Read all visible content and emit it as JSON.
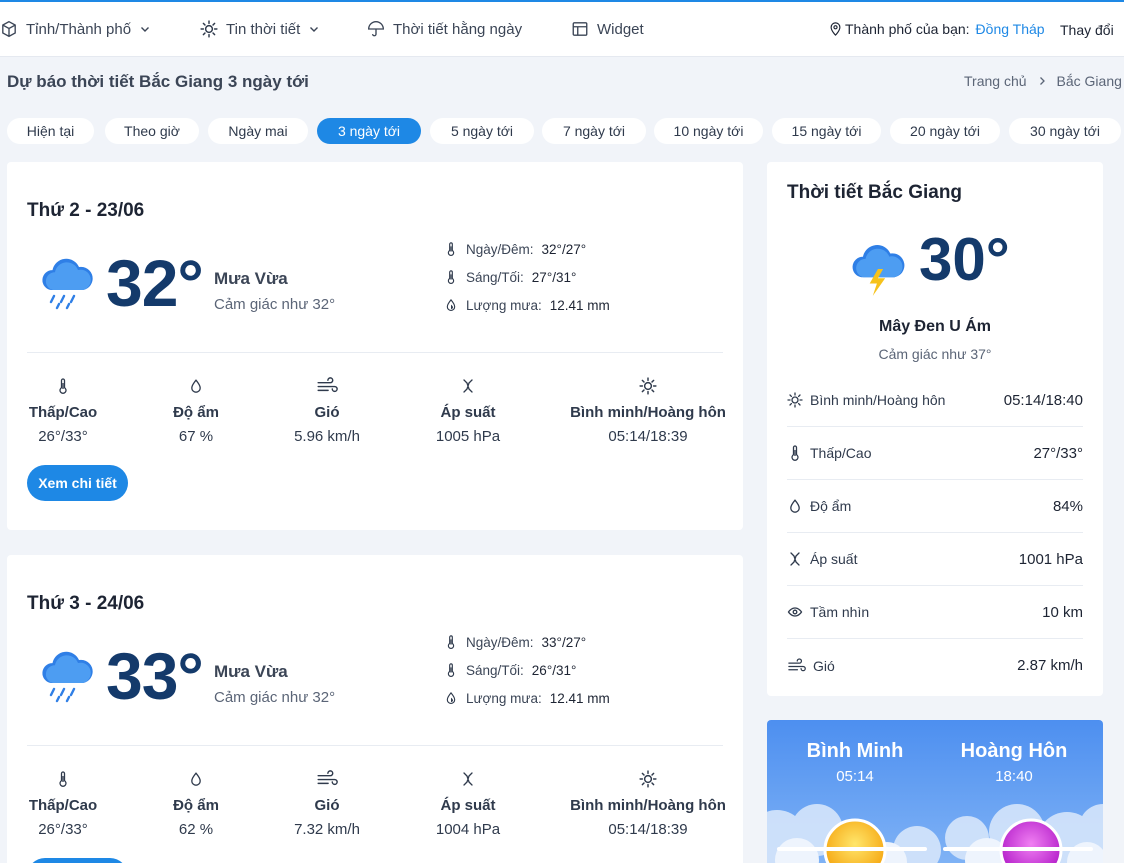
{
  "nav": {
    "items": [
      {
        "label": "Tỉnh/Thành phố",
        "icon": "box-icon",
        "dropdown": true
      },
      {
        "label": "Tin thời tiết",
        "icon": "sun-icon",
        "dropdown": true
      },
      {
        "label": "Thời tiết hằng ngày",
        "icon": "umbrella-icon",
        "dropdown": false
      },
      {
        "label": "Widget",
        "icon": "table-icon",
        "dropdown": false
      }
    ],
    "city_prefix": "Thành phố của bạn:",
    "city_name": "Đồng Tháp",
    "change_label": "Thay đổi"
  },
  "page": {
    "title": "Dự báo thời tiết Bắc Giang 3 ngày tới",
    "breadcrumb": [
      "Trang chủ",
      "Bắc Giang"
    ]
  },
  "tabs": [
    {
      "label": "Hiện tại",
      "active": false
    },
    {
      "label": "Theo giờ",
      "active": false
    },
    {
      "label": "Ngày mai",
      "active": false
    },
    {
      "label": "3 ngày tới",
      "active": true
    },
    {
      "label": "5 ngày tới",
      "active": false
    },
    {
      "label": "7 ngày tới",
      "active": false
    },
    {
      "label": "10 ngày tới",
      "active": false
    },
    {
      "label": "15 ngày tới",
      "active": false
    },
    {
      "label": "20 ngày tới",
      "active": false
    },
    {
      "label": "30 ngày tới",
      "active": false
    }
  ],
  "days": [
    {
      "title": "Thứ 2 - 23/06",
      "temp": "32°",
      "condition": "Mưa Vừa",
      "feels_like": "Cảm giác như 32°",
      "details": [
        {
          "label": "Ngày/Đêm:",
          "value": "32°/27°"
        },
        {
          "label": "Sáng/Tối:",
          "value": "27°/31°"
        },
        {
          "label": "Lượng mưa:",
          "value": "12.41 mm"
        }
      ],
      "stats": [
        {
          "label": "Thấp/Cao",
          "value": "26°/33°"
        },
        {
          "label": "Độ ẩm",
          "value": "67 %"
        },
        {
          "label": "Gió",
          "value": "5.96 km/h"
        },
        {
          "label": "Áp suất",
          "value": "1005 hPa"
        },
        {
          "label": "Bình minh/Hoàng hôn",
          "value": "05:14/18:39"
        }
      ],
      "button": "Xem chi tiết"
    },
    {
      "title": "Thứ 3 - 24/06",
      "temp": "33°",
      "condition": "Mưa Vừa",
      "feels_like": "Cảm giác như 32°",
      "details": [
        {
          "label": "Ngày/Đêm:",
          "value": "33°/27°"
        },
        {
          "label": "Sáng/Tối:",
          "value": "26°/31°"
        },
        {
          "label": "Lượng mưa:",
          "value": "12.41 mm"
        }
      ],
      "stats": [
        {
          "label": "Thấp/Cao",
          "value": "26°/33°"
        },
        {
          "label": "Độ ẩm",
          "value": "62 %"
        },
        {
          "label": "Gió",
          "value": "7.32 km/h"
        },
        {
          "label": "Áp suất",
          "value": "1004 hPa"
        },
        {
          "label": "Bình minh/Hoàng hôn",
          "value": "05:14/18:39"
        }
      ]
    }
  ],
  "current": {
    "title": "Thời tiết Bắc Giang",
    "temp": "30°",
    "condition": "Mây Đen U Ám",
    "feels_like": "Cảm giác như 37°",
    "rows": [
      {
        "label": "Bình minh/Hoàng hôn",
        "value": "05:14/18:40",
        "icon": "sun-icon"
      },
      {
        "label": "Thấp/Cao",
        "value": "27°/33°",
        "icon": "thermometer-icon"
      },
      {
        "label": "Độ ẩm",
        "value": "84%",
        "icon": "droplet-icon"
      },
      {
        "label": "Áp suất",
        "value": "1001 hPa",
        "icon": "pressure-icon"
      },
      {
        "label": "Tầm nhìn",
        "value": "10 km",
        "icon": "eye-icon"
      },
      {
        "label": "Gió",
        "value": "2.87 km/h",
        "icon": "wind-icon"
      }
    ]
  },
  "sun": {
    "sunrise_label": "Bình Minh",
    "sunrise_time": "05:14",
    "sunset_label": "Hoàng Hôn",
    "sunset_time": "18:40"
  },
  "colors": {
    "accent": "#1e88e5",
    "temp_text": "#143a6b",
    "page_bg": "#f1f4f9",
    "sun_card": "#4d8ff0"
  }
}
